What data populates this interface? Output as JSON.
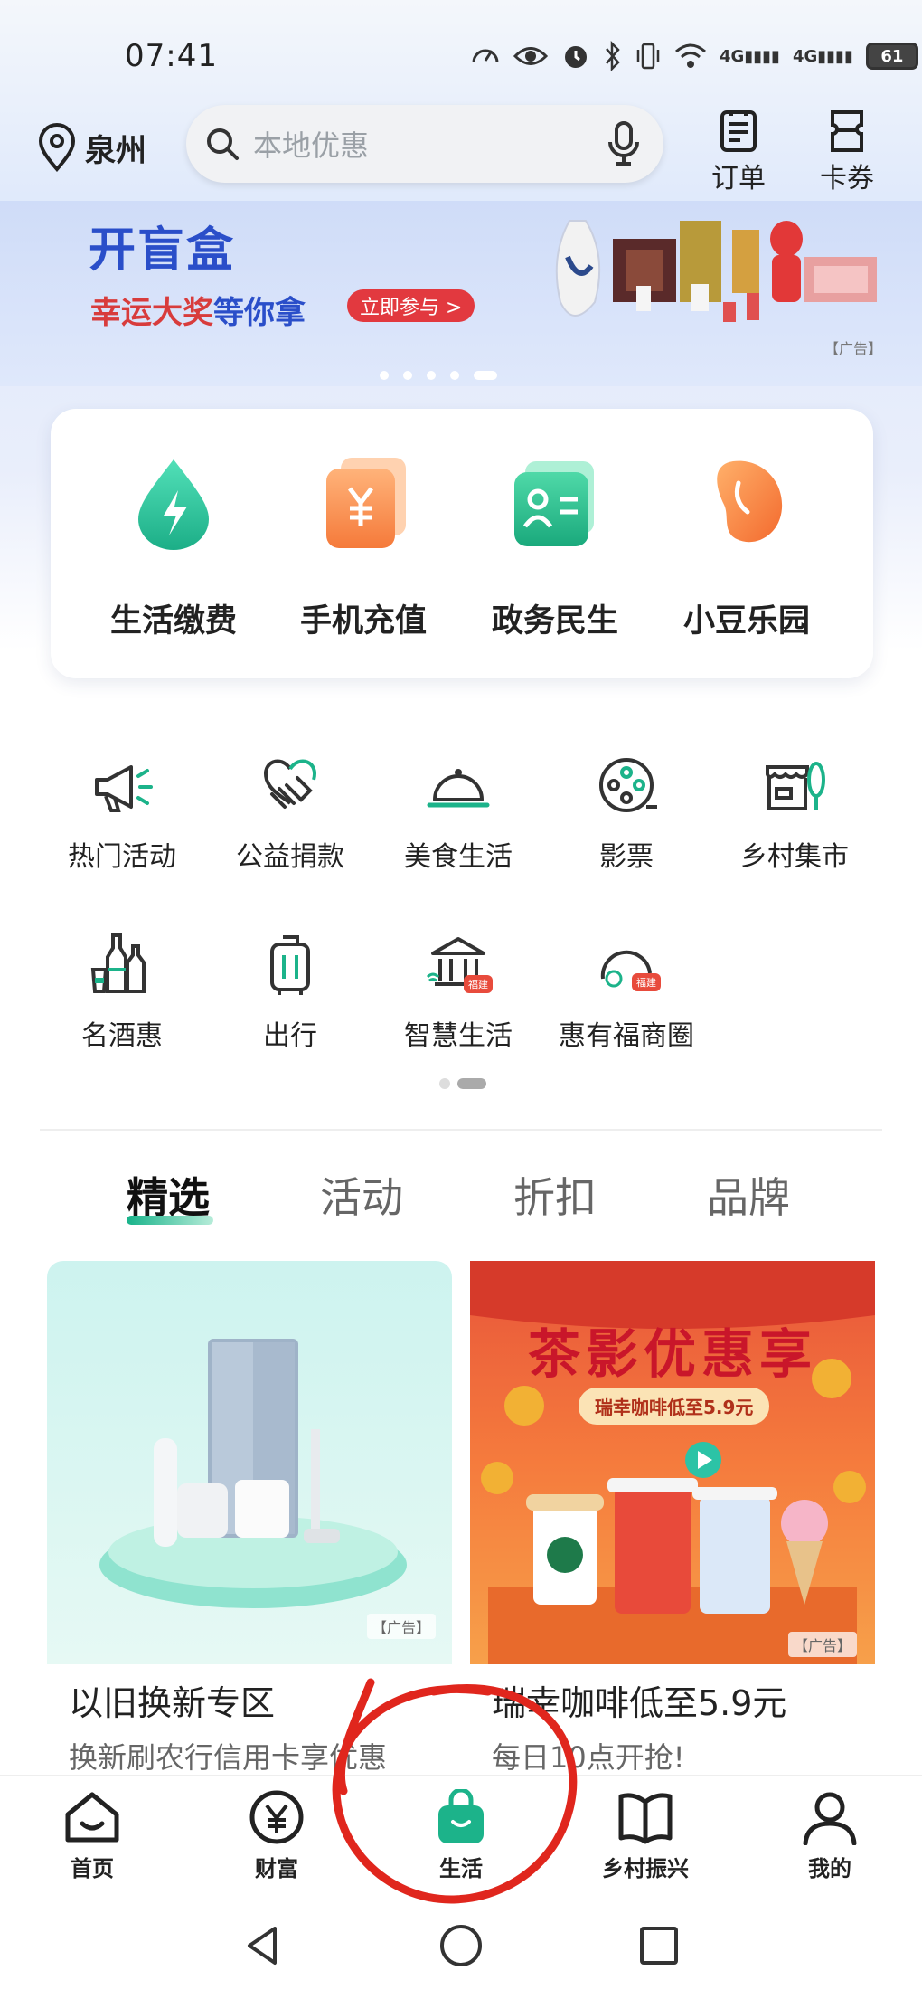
{
  "status_bar": {
    "time": "07:41",
    "network_1": "4G",
    "network_2": "4G",
    "battery": "61"
  },
  "header": {
    "location": "泉州",
    "search_placeholder": "本地优惠",
    "orders_label": "订单",
    "coupons_label": "卡券"
  },
  "banner": {
    "title": "开盲盒",
    "subtitle_red": "幸运大奖",
    "subtitle_blue": "等你拿",
    "cta": "立即参与 >",
    "ad_tag": "【广告】",
    "page_count": 5,
    "active_page": 5
  },
  "quick_services": [
    {
      "label": "生活缴费",
      "icon": "lightning-drop-icon"
    },
    {
      "label": "手机充值",
      "icon": "yuan-card-icon"
    },
    {
      "label": "政务民生",
      "icon": "id-card-icon"
    },
    {
      "label": "小豆乐园",
      "icon": "bean-icon"
    }
  ],
  "service_grid": [
    {
      "label": "热门活动",
      "icon": "megaphone-icon"
    },
    {
      "label": "公益捐款",
      "icon": "handshake-heart-icon"
    },
    {
      "label": "美食生活",
      "icon": "food-cloche-icon"
    },
    {
      "label": "影票",
      "icon": "film-reel-icon"
    },
    {
      "label": "乡村集市",
      "icon": "market-stall-icon"
    },
    {
      "label": "名酒惠",
      "icon": "wine-bottles-icon"
    },
    {
      "label": "出行",
      "icon": "luggage-icon"
    },
    {
      "label": "智慧生活",
      "icon": "smart-bank-icon",
      "badge": "福建"
    },
    {
      "label": "惠有福商圈",
      "icon": "business-circle-icon",
      "badge": "福建"
    }
  ],
  "grid_pager": {
    "page_count": 2,
    "active_page": 2
  },
  "tabs": [
    {
      "label": "精选",
      "active": true
    },
    {
      "label": "活动",
      "active": false
    },
    {
      "label": "折扣",
      "active": false
    },
    {
      "label": "品牌",
      "active": false
    }
  ],
  "cards": [
    {
      "title": "以旧换新专区",
      "subtitle": "换新刷农行信用卡享优惠",
      "ad_tag": "【广告】"
    },
    {
      "title": "瑞幸咖啡低至5.9元",
      "subtitle": "每日10点开抢!",
      "ad_tag": "【广告】",
      "promo_title": "茶影优惠享",
      "promo_pill": "瑞幸咖啡低至5.9元"
    }
  ],
  "bottom_nav": [
    {
      "label": "首页",
      "icon": "home-icon",
      "active": false
    },
    {
      "label": "财富",
      "icon": "yuan-coin-icon",
      "active": false
    },
    {
      "label": "生活",
      "icon": "shopping-bag-icon",
      "active": true
    },
    {
      "label": "乡村振兴",
      "icon": "open-book-icon",
      "active": false
    },
    {
      "label": "我的",
      "icon": "person-icon",
      "active": false
    }
  ],
  "colors": {
    "brand_green": "#18b38a",
    "banner_blue": "#2a4ec9",
    "accent_red": "#e2393f"
  }
}
